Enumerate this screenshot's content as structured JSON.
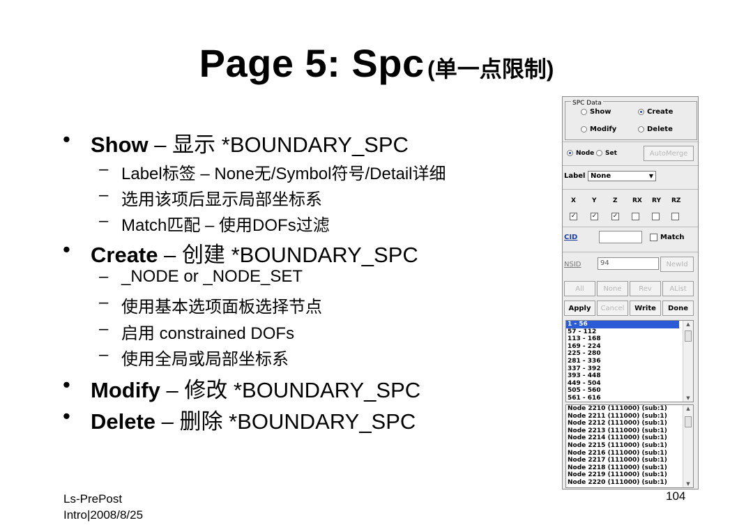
{
  "title": {
    "main": "Page 5: Spc",
    "sub": "(单一点限制)"
  },
  "bullets": [
    {
      "bold": "Show",
      "rest": " – 显示 *BOUNDARY_SPC",
      "subs": [
        "Label标签 – None无/Symbol符号/Detail详细",
        "选用该项后显示局部坐标系",
        "Match匹配 – 使用DOFs过滤"
      ]
    },
    {
      "bold": "Create",
      "rest": " – 创建 *BOUNDARY_SPC",
      "subs": [
        "_NODE or _NODE_SET",
        "使用基本选项面板选择节点",
        "启用 constrained DOFs",
        "使用全局或局部坐标系"
      ]
    },
    {
      "bold": "Modify",
      "rest": " – 修改 *BOUNDARY_SPC",
      "subs": []
    },
    {
      "bold": "Delete",
      "rest": " – 删除 *BOUNDARY_SPC",
      "subs": []
    }
  ],
  "markers": {
    "bullet": "•",
    "dash": "–"
  },
  "footer": {
    "line1": "Ls-PrePost",
    "line2": "Intro|2008/8/25",
    "page": "104"
  },
  "panel": {
    "legend": "SPC Data",
    "mode": {
      "show": "Show",
      "create": "Create",
      "modify": "Modify",
      "delete": "Delete",
      "selected": "create"
    },
    "target": {
      "node": "Node",
      "set": "Set",
      "selected": "node"
    },
    "automerge": "AutoMerge",
    "label_label": "Label",
    "label_value": "None",
    "dofs": [
      {
        "name": "X",
        "checked": true
      },
      {
        "name": "Y",
        "checked": true
      },
      {
        "name": "Z",
        "checked": true
      },
      {
        "name": "RX",
        "checked": false
      },
      {
        "name": "RY",
        "checked": false
      },
      {
        "name": "RZ",
        "checked": false
      }
    ],
    "check_mark": "✓",
    "cid_label": "CID",
    "cid_value": "",
    "match_label": "Match",
    "nsid_label": "NSID",
    "nsid_value": "94",
    "newid": "NewId",
    "row1": [
      "All",
      "None",
      "Rev",
      "AList"
    ],
    "row2": [
      "Apply",
      "Cancel",
      "Write",
      "Done"
    ],
    "ranges": [
      "1 - 56",
      "57 - 112",
      "113 - 168",
      "169 - 224",
      "225 - 280",
      "281 - 336",
      "337 - 392",
      "393 - 448",
      "449 - 504",
      "505 - 560",
      "561 - 616"
    ],
    "nodes": [
      "Node 2210 (111000) (sub:1)",
      "Node 2211 (111000) (sub:1)",
      "Node 2212 (111000) (sub:1)",
      "Node 2213 (111000) (sub:1)",
      "Node 2214 (111000) (sub:1)",
      "Node 2215 (111000) (sub:1)",
      "Node 2216 (111000) (sub:1)",
      "Node 2217 (111000) (sub:1)",
      "Node 2218 (111000) (sub:1)",
      "Node 2219 (111000) (sub:1)",
      "Node 2220 (111000) (sub:1)"
    ],
    "scroll_up": "▲",
    "scroll_down": "▼",
    "dropdown_arrow": "▼"
  }
}
